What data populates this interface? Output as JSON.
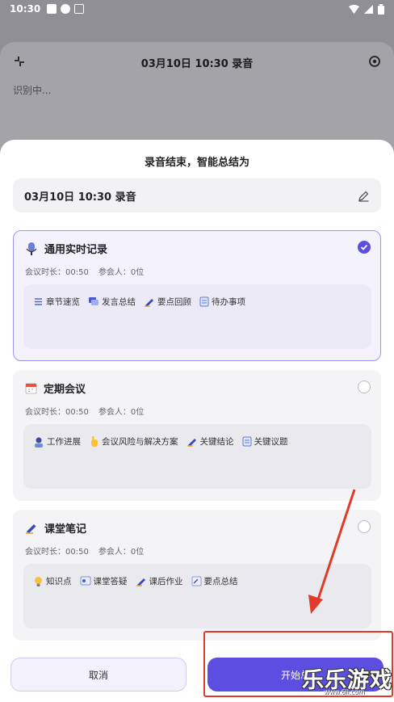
{
  "status_bar": {
    "time": "10:30"
  },
  "background_card": {
    "title": "03月10日 10:30 录音",
    "status": "识别中..."
  },
  "sheet": {
    "title": "录音结束，智能总结为",
    "recording_name": "03月10日 10:30 录音"
  },
  "templates": [
    {
      "title": "通用实时记录",
      "duration": "会议时长：00:50",
      "participants": "参会人：0位",
      "selected": true,
      "features": [
        {
          "label": "章节速览",
          "icon": "list-icon"
        },
        {
          "label": "发言总结",
          "icon": "chat-icon"
        },
        {
          "label": "要点回顾",
          "icon": "pen-icon"
        },
        {
          "label": "待办事项",
          "icon": "checklist-icon"
        }
      ]
    },
    {
      "title": "定期会议",
      "duration": "会议时长：00:50",
      "participants": "参会人：0位",
      "selected": false,
      "features": [
        {
          "label": "工作进展",
          "icon": "person-icon"
        },
        {
          "label": "会议风险与解决方案",
          "icon": "hand-icon"
        },
        {
          "label": "关键结论",
          "icon": "pen-icon"
        },
        {
          "label": "关键议题",
          "icon": "checklist-icon"
        }
      ]
    },
    {
      "title": "课堂笔记",
      "duration": "会议时长：00:50",
      "participants": "参会人：0位",
      "selected": false,
      "features": [
        {
          "label": "知识点",
          "icon": "bulb-icon"
        },
        {
          "label": "课堂答疑",
          "icon": "qa-icon"
        },
        {
          "label": "课后作业",
          "icon": "pen-icon"
        },
        {
          "label": "要点总结",
          "icon": "note-icon"
        }
      ]
    }
  ],
  "buttons": {
    "cancel": "取消",
    "start": "开始总"
  },
  "watermark": {
    "main": "乐乐游戏",
    "sub": "www.6ll.com"
  },
  "colors": {
    "accent": "#5b4ee0",
    "annotation": "#e03b2a"
  }
}
